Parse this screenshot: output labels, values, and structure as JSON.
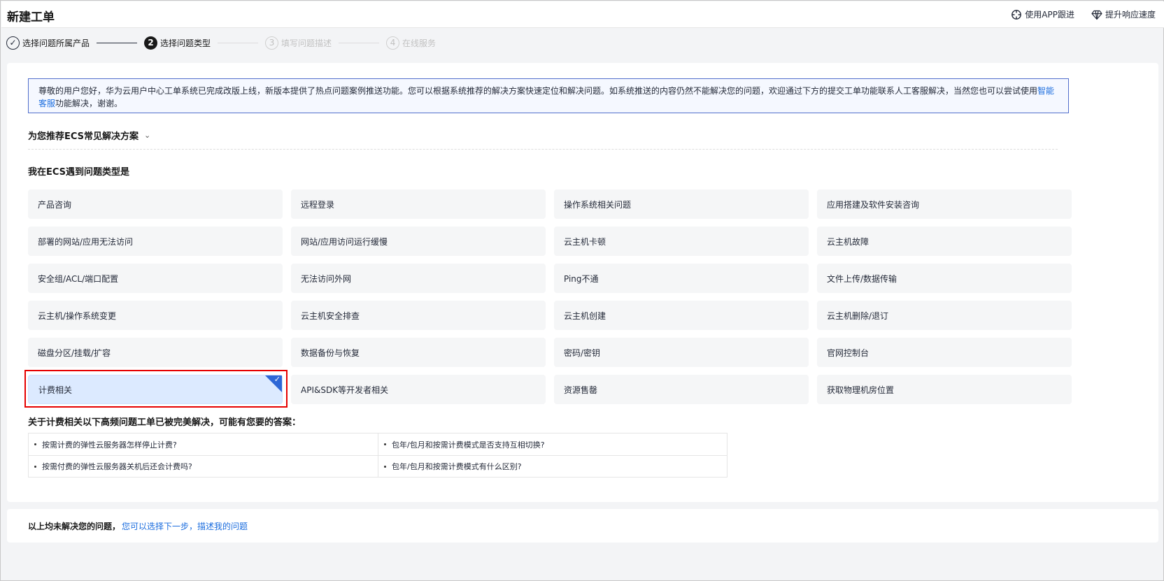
{
  "header": {
    "title": "新建工单",
    "actions": {
      "app_track": "使用APP跟进",
      "speed_up": "提升响应速度"
    }
  },
  "steps": [
    {
      "num": "✓",
      "label": "选择问题所属产品",
      "state": "done"
    },
    {
      "num": "2",
      "label": "选择问题类型",
      "state": "active"
    },
    {
      "num": "3",
      "label": "填写问题描述",
      "state": "pending"
    },
    {
      "num": "4",
      "label": "在线服务",
      "state": "pending"
    }
  ],
  "notice": {
    "text": "尊敬的用户您好，华为云用户中心工单系统已完成改版上线，新版本提供了热点问题案例推送功能。您可以根据系统推荐的解决方案快速定位和解决问题。如系统推送的内容仍然不能解决您的问题，欢迎通过下方的提交工单功能联系人工客服解决，当然您也可以尝试使用",
    "link": "智能客服",
    "suffix": "功能解决，谢谢。"
  },
  "recommend_title": "为您推荐ECS常见解决方案",
  "type_title": "我在ECS遇到问题类型是",
  "options": [
    "产品咨询",
    "远程登录",
    "操作系统相关问题",
    "应用搭建及软件安装咨询",
    "部署的网站/应用无法访问",
    "网站/应用访问运行缓慢",
    "云主机卡顿",
    "云主机故障",
    "安全组/ACL/端口配置",
    "无法访问外网",
    "Ping不通",
    "文件上传/数据传输",
    "云主机/操作系统变更",
    "云主机安全排查",
    "云主机创建",
    "云主机删除/退订",
    "磁盘分区/挂载/扩容",
    "数据备份与恢复",
    "密码/密钥",
    "官网控制台",
    "计费相关",
    "API&SDK等开发者相关",
    "资源售罄",
    "获取物理机房位置"
  ],
  "selected_option": "计费相关",
  "faq_title": "关于计费相关以下高频问题工单已被完美解决，可能有您要的答案：",
  "faq": [
    [
      "按需计费的弹性云服务器怎样停止计费?",
      "包年/包月和按需计费模式是否支持互相切换?"
    ],
    [
      "按需付费的弹性云服务器关机后还会计费吗?",
      "包年/包月和按需计费模式有什么区别?"
    ]
  ],
  "bottom": {
    "text": "以上均未解决您的问题，",
    "link": "您可以选择下一步，描述我的问题"
  },
  "colors": {
    "accent": "#2e67d6",
    "link": "#1a6cde",
    "highlight": "#e60000"
  }
}
